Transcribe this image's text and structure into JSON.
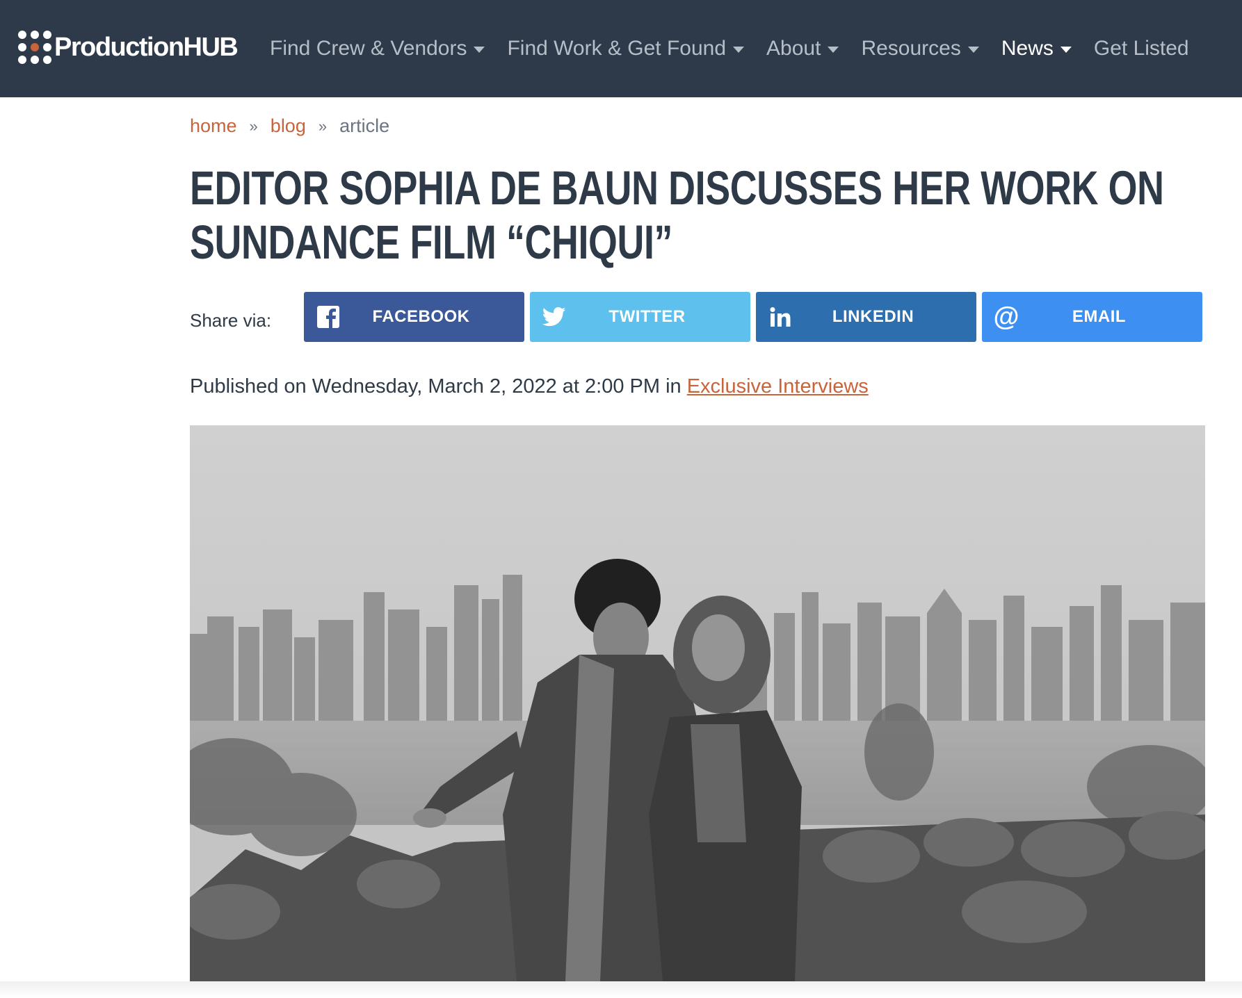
{
  "brand": {
    "logo_text": "ProductionHUB",
    "accent": "#c8643a",
    "nav_bg": "#2e3a4a"
  },
  "nav": {
    "items": [
      {
        "label": "Find Crew & Vendors",
        "has_dropdown": true
      },
      {
        "label": "Find Work & Get Found",
        "has_dropdown": true
      },
      {
        "label": "About",
        "has_dropdown": true
      },
      {
        "label": "Resources",
        "has_dropdown": true
      },
      {
        "label": "News",
        "has_dropdown": true,
        "active": true
      },
      {
        "label": "Get Listed",
        "has_dropdown": false
      }
    ]
  },
  "breadcrumb": {
    "home": "home",
    "blog": "blog",
    "current": "article",
    "separator": "»"
  },
  "article": {
    "title": "EDITOR SOPHIA DE BAUN DISCUSSES HER WORK ON SUNDANCE FILM “CHIQUI”",
    "published_prefix": "Published on Wednesday, March 2, 2022 at 2:00 PM in ",
    "category": "Exclusive Interviews"
  },
  "share": {
    "label": "Share via:",
    "buttons": [
      {
        "label": "FACEBOOK",
        "icon": "facebook-icon",
        "color": "#3b5998"
      },
      {
        "label": "TWITTER",
        "icon": "twitter-icon",
        "color": "#5ec0ec"
      },
      {
        "label": "LINKEDIN",
        "icon": "linkedin-icon",
        "color": "#2d6eae"
      },
      {
        "label": "EMAIL",
        "icon": "at-icon",
        "color": "#3d8ff2"
      }
    ]
  }
}
